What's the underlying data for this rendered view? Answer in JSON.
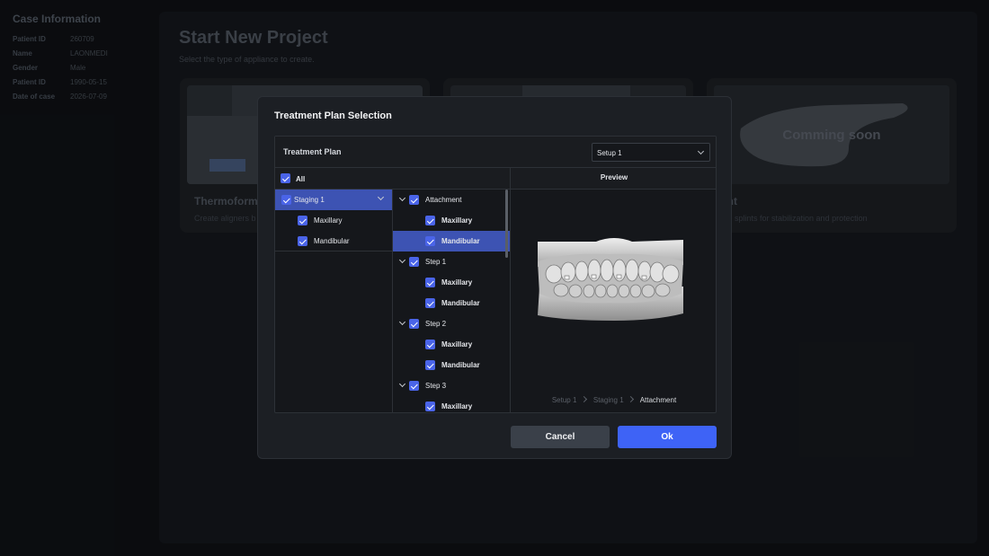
{
  "sidebar": {
    "title": "Case Information",
    "fields": [
      {
        "label": "Patient ID",
        "value": "260709"
      },
      {
        "label": "Name",
        "value": "LAONMEDI"
      },
      {
        "label": "Gender",
        "value": "Male"
      },
      {
        "label": "Patient ID",
        "value": "1990-05-15"
      },
      {
        "label": "Date of case",
        "value": "2026-07-09"
      }
    ]
  },
  "main": {
    "title": "Start New Project",
    "subtitle": "Select the type of appliance to create.",
    "cards": [
      {
        "title": "Thermoformi",
        "desc": "Create aligners b"
      },
      {
        "title": "",
        "desc": ""
      },
      {
        "title": "lint",
        "desc": "ate splints for stabilization and protection",
        "badge": "Comming soon"
      }
    ]
  },
  "dialog": {
    "title": "Treatment Plan Selection",
    "plan_label": "Treatment Plan",
    "plan_select": "Setup 1",
    "all_label": "All",
    "preview_label": "Preview",
    "staging_column": [
      {
        "label": "Staging 1",
        "checked": true,
        "selected": true,
        "expanded": true
      },
      {
        "label": "Maxillary",
        "checked": true
      },
      {
        "label": "Mandibular",
        "checked": true
      }
    ],
    "tree": [
      {
        "label": "Attachment",
        "level": 0
      },
      {
        "label": "Maxillary",
        "level": 1
      },
      {
        "label": "Mandibular",
        "level": 1,
        "selected": true
      },
      {
        "label": "Step 1",
        "level": 0
      },
      {
        "label": "Maxillary",
        "level": 1
      },
      {
        "label": "Mandibular",
        "level": 1
      },
      {
        "label": "Step 2",
        "level": 0
      },
      {
        "label": "Maxillary",
        "level": 1
      },
      {
        "label": "Mandibular",
        "level": 1
      },
      {
        "label": "Step 3",
        "level": 0
      },
      {
        "label": "Maxillary",
        "level": 1
      }
    ],
    "breadcrumb": [
      "Setup 1",
      "Staging 1",
      "Attachment"
    ],
    "cancel_label": "Cancel",
    "ok_label": "Ok"
  },
  "colors": {
    "accent": "#3e63f6",
    "selected_row": "#3d53b3",
    "dialog_bg": "#1c1f24",
    "cancel_bg": "#3a4049"
  }
}
